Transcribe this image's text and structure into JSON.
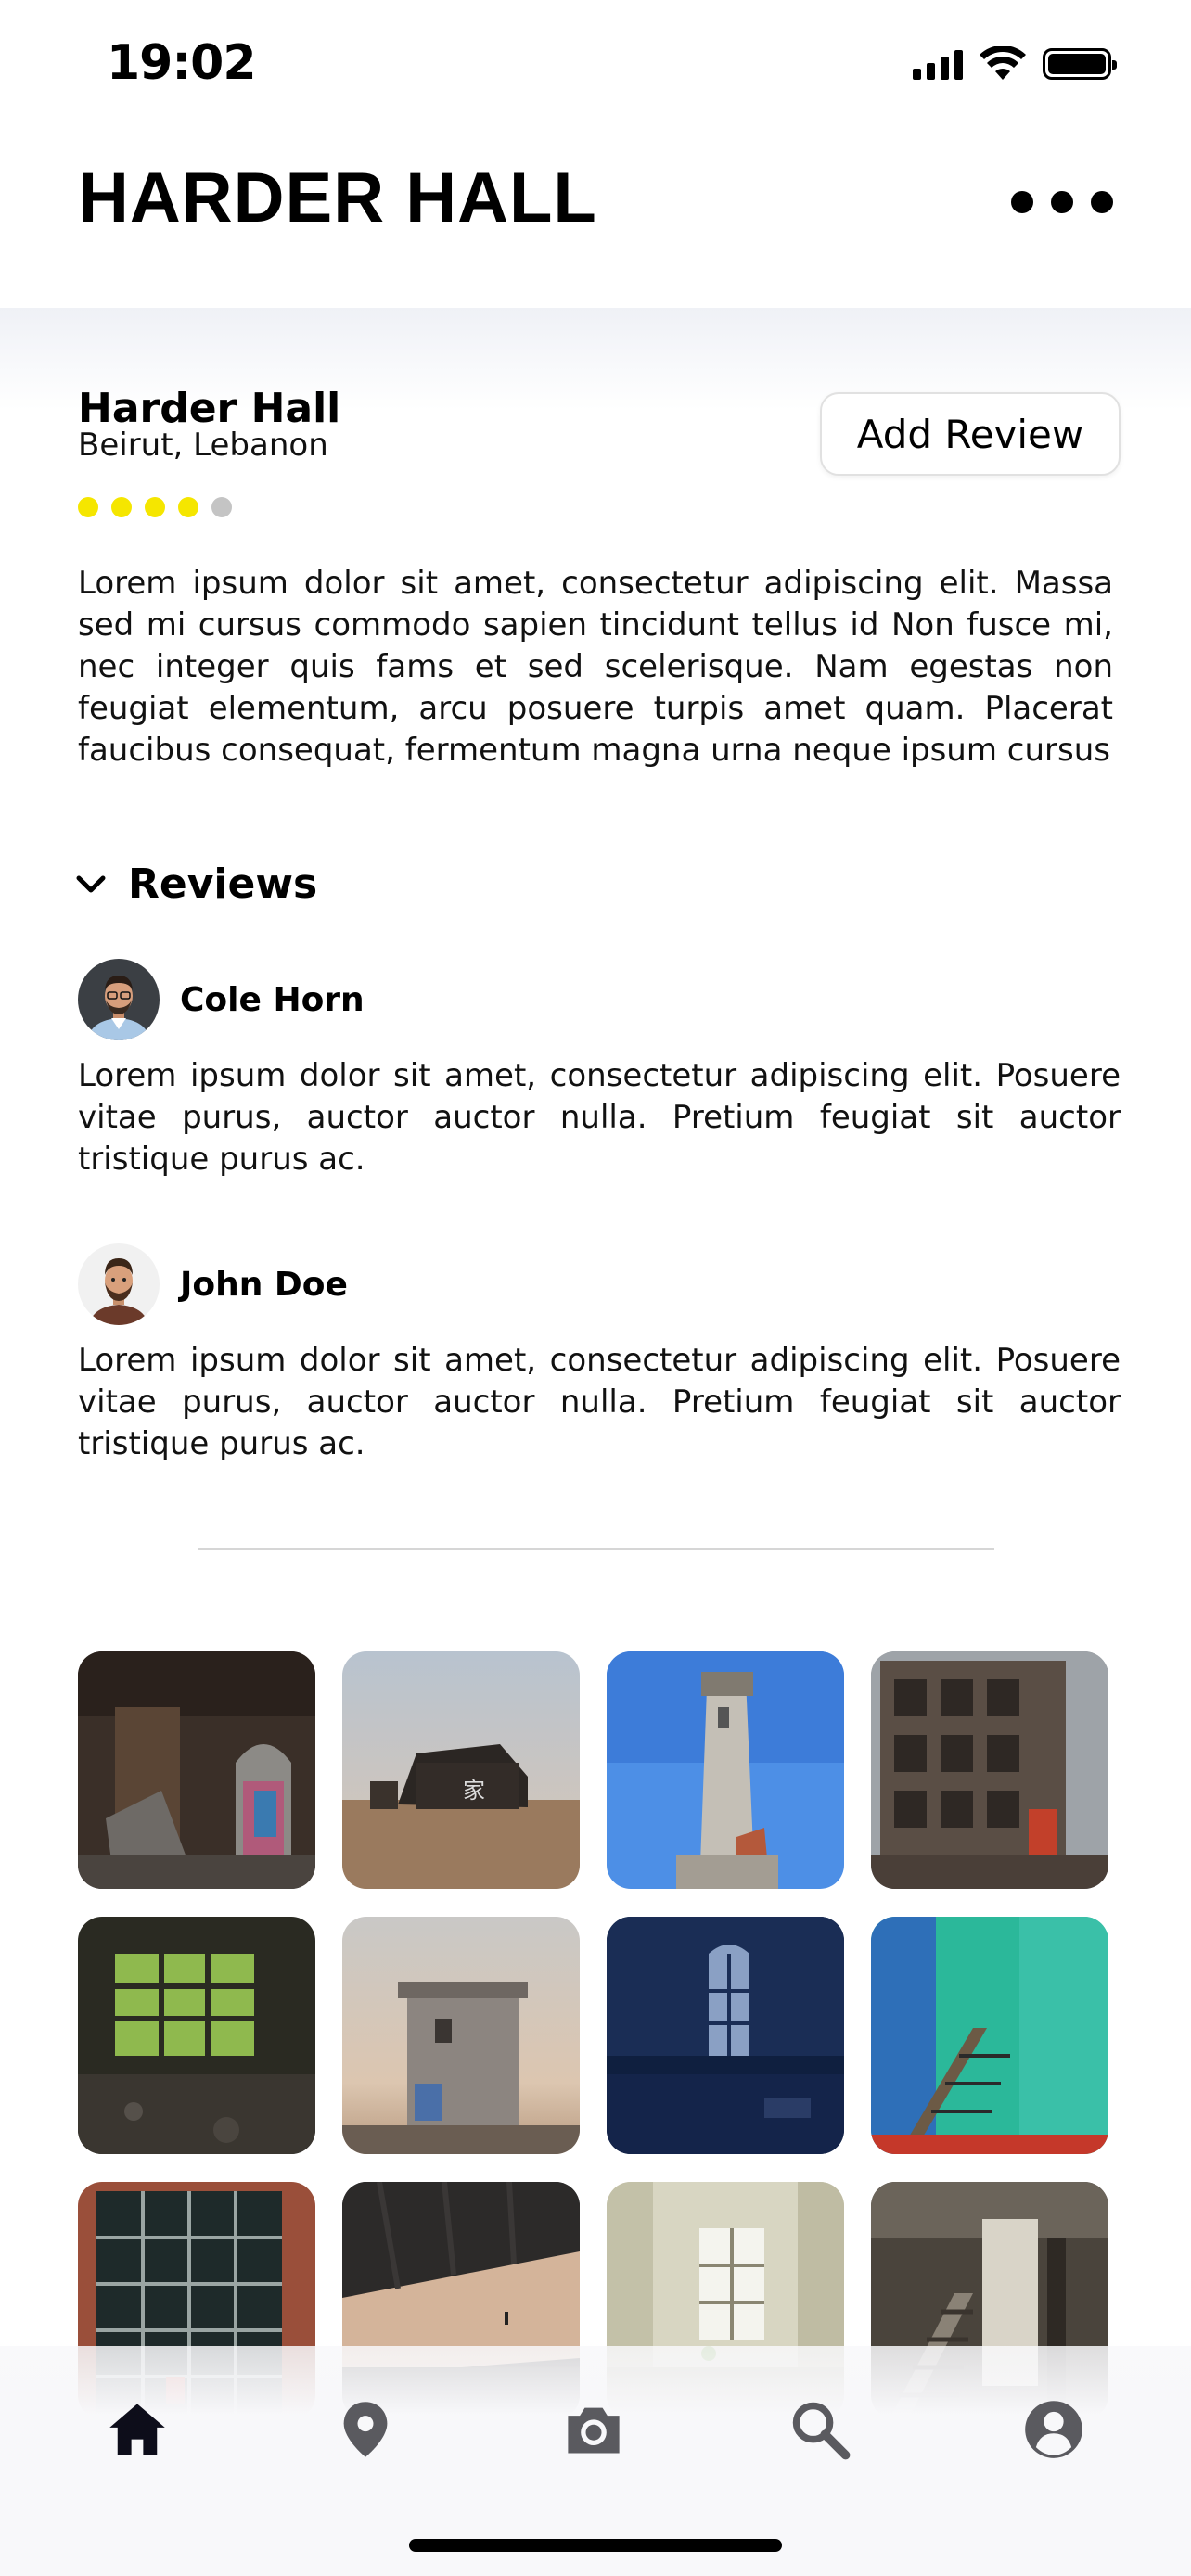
{
  "status_bar": {
    "time": "19:02"
  },
  "header": {
    "title": "HARDER HALL",
    "menu_icon": "more-dots-icon"
  },
  "place": {
    "name": "Harder Hall",
    "location": "Beirut, Lebanon",
    "rating": 4,
    "rating_max": 5,
    "add_review_label": "Add Review",
    "description": "Lorem ipsum dolor sit amet, consectetur adipiscing elit. Massa sed mi cursus commodo sapien tincidunt tellus id Non fusce mi, nec integer quis fams et sed scelerisque. Nam egestas non feugiat elementum, arcu posuere turpis amet quam. Placerat faucibus consequat, fermentum magna urna neque ipsum cursus"
  },
  "reviews": {
    "title": "Reviews",
    "items": [
      {
        "name": "Cole Horn",
        "text": "Lorem ipsum dolor sit amet, consectetur adipiscing elit. Posuere vitae purus, auctor auctor nulla. Pretium feugiat sit auctor tristique purus ac."
      },
      {
        "name": "John Doe",
        "text": "Lorem ipsum dolor sit amet, consectetur adipiscing elit. Posuere vitae purus, auctor auctor nulla. Pretium feugiat sit auctor tristique purus ac."
      }
    ]
  },
  "tabbar": {
    "items": [
      {
        "icon": "home-icon",
        "active": true
      },
      {
        "icon": "map-pin-icon",
        "active": false
      },
      {
        "icon": "camera-icon",
        "active": false
      },
      {
        "icon": "search-icon",
        "active": false
      },
      {
        "icon": "profile-icon",
        "active": false
      }
    ]
  },
  "colors": {
    "rating_active": "#f5e600",
    "rating_inactive": "#c4c4c4",
    "tab_active": "#0d0d1a",
    "tab_inactive": "#5a5a5f"
  }
}
